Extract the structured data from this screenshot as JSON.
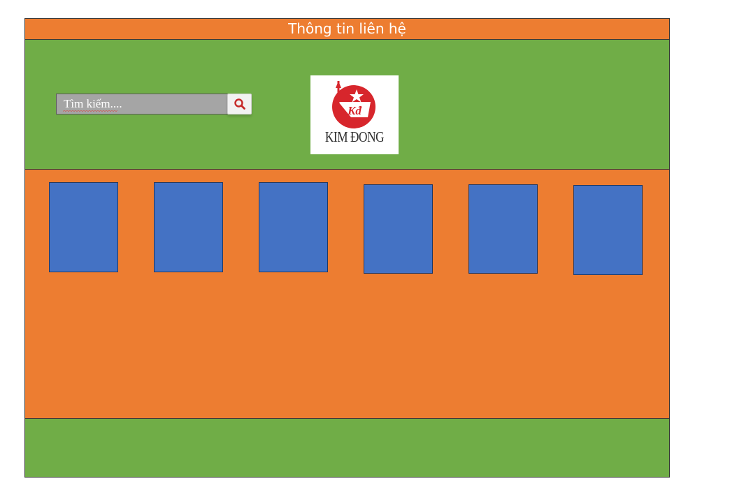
{
  "top_bar": {
    "title": "Thông tin liên hệ"
  },
  "header": {
    "search": {
      "placeholder": "Tìm kiếm...."
    },
    "logo": {
      "text": "KIM ĐONG",
      "emblem_text": "Kđ"
    }
  },
  "main": {
    "cards": [
      {
        "id": 1
      },
      {
        "id": 2
      },
      {
        "id": 3
      },
      {
        "id": 4
      },
      {
        "id": 5
      },
      {
        "id": 6
      }
    ]
  },
  "colors": {
    "top_bar": "#ed7d31",
    "header": "#70ad47",
    "main": "#ed7d31",
    "footer": "#70ad47",
    "card": "#4472c4",
    "logo_red": "#d7262c",
    "search_icon": "#c62828"
  },
  "icons": {
    "search": "search-icon",
    "logo": "kim-dong-logo"
  }
}
